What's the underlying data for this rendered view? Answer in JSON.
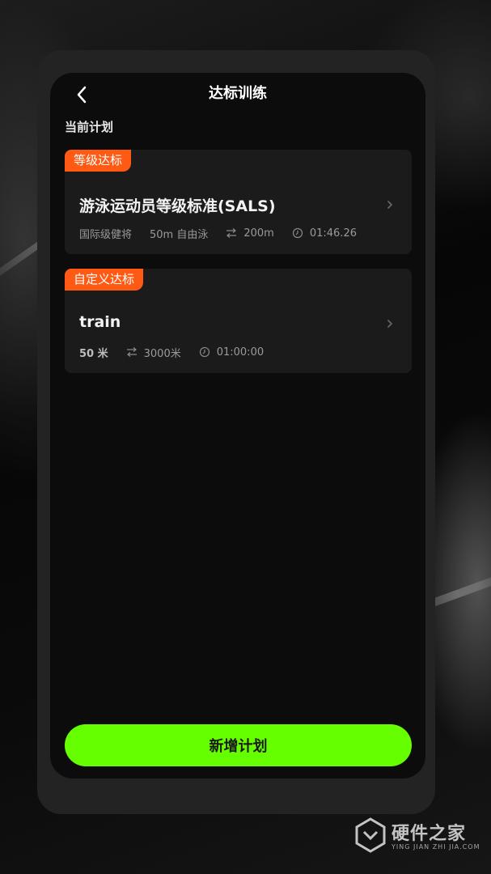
{
  "header": {
    "title": "达标训练"
  },
  "section": {
    "current_plan_label": "当前计划"
  },
  "cards": [
    {
      "tag": "等级达标",
      "title": "游泳运动员等级标准(SALS)",
      "level": "国际级健将",
      "event": "50m 自由泳",
      "distance": "200m",
      "time": "01:46.26"
    },
    {
      "tag": "自定义达标",
      "title": "train",
      "pool": "50 米",
      "distance": "3000米",
      "time": "01:00:00"
    }
  ],
  "actions": {
    "add_plan_label": "新增计划"
  },
  "watermark": {
    "brand": "硬件之家",
    "sub": "YING JIAN ZHI JIA.COM"
  },
  "colors": {
    "accent_green": "#66ff00",
    "tag_orange": "#ff5a14",
    "card_bg": "#1b1b1b",
    "screen_bg": "#0c0c0c"
  },
  "icons": [
    "back-arrow-icon",
    "chevron-right-icon",
    "distance-icon",
    "clock-icon"
  ]
}
